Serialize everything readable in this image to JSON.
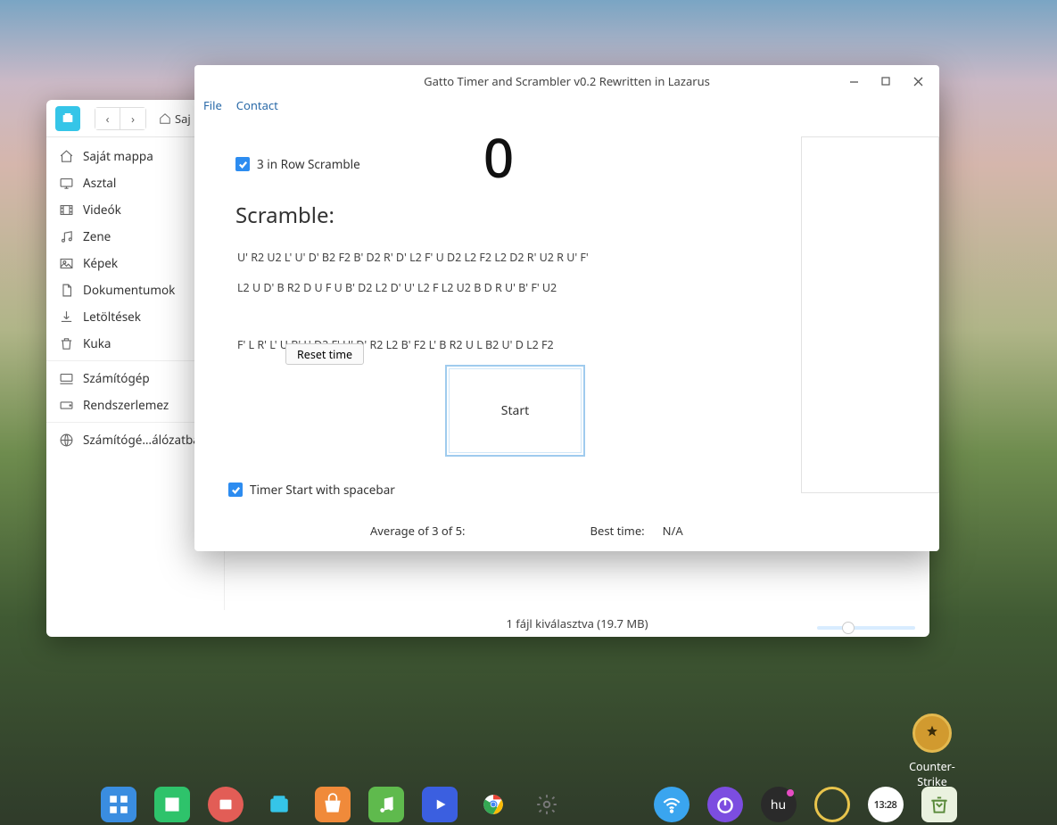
{
  "desktop": {
    "app_icon_label": "Counter-Strike"
  },
  "file_manager": {
    "breadcrumb": "Saj",
    "sidebar": {
      "items": [
        {
          "label": "Saját mappa",
          "icon": "home"
        },
        {
          "label": "Asztal",
          "icon": "desktop"
        },
        {
          "label": "Videók",
          "icon": "video"
        },
        {
          "label": "Zene",
          "icon": "music"
        },
        {
          "label": "Képek",
          "icon": "image"
        },
        {
          "label": "Dokumentumok",
          "icon": "document"
        },
        {
          "label": "Letöltések",
          "icon": "download"
        },
        {
          "label": "Kuka",
          "icon": "trash"
        }
      ],
      "devices": [
        {
          "label": "Számítógép",
          "icon": "computer"
        },
        {
          "label": "Rendszerlemez",
          "icon": "disk"
        }
      ],
      "network": [
        {
          "label": "Számítógé…álózatban",
          "icon": "globe"
        }
      ]
    },
    "status_text": "1 fájl kiválasztva (19.7 MB)"
  },
  "app": {
    "title": "Gatto Timer and Scrambler v0.2 Rewritten in Lazarus",
    "menu": {
      "file": "File",
      "contact": "Contact"
    },
    "checkbox_3row": "3 in Row Scramble",
    "checkbox_spacebar": "Timer Start with spacebar",
    "timer_display": "0",
    "scramble_label": "Scramble:",
    "scramble_lines": [
      "U' R2 U2 L' U' D' B2 F2 B' D2 R' D' L2 F' U D2 L2 F2 L2 D2 R' U2 R U' F'",
      "L2 U D' B R2 D U F U B' D2 L2 D' U' L2 F L2 U2 B D R U' B' F' U2",
      "F' L R' L' U B' L' D2 F' U' D' R2 L2 B' F2 L' B R2 U L B2 U' D L2 F2"
    ],
    "reset_label": "Reset time",
    "start_label": "Start",
    "avg_label": "Average of 3 of 5:",
    "best_label": "Best time:",
    "best_value": "N/A"
  },
  "taskbar": {
    "lang": "hu",
    "clock": "13:28"
  }
}
